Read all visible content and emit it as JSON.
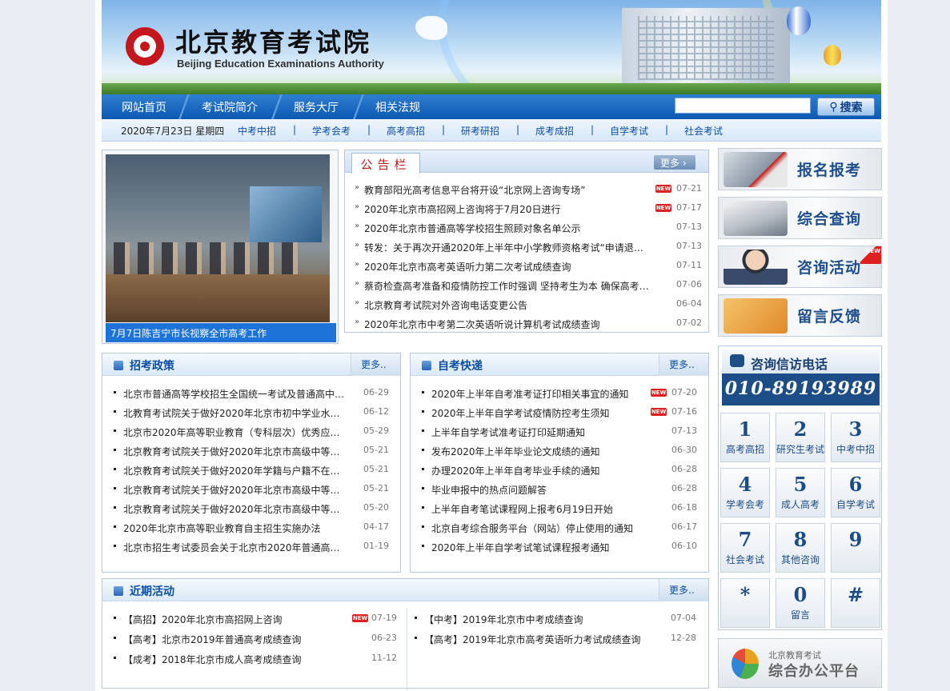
{
  "header": {
    "logo_cn": "北京教育考试院",
    "logo_en": "Beijing Education Examinations Authority"
  },
  "nav": {
    "items": [
      "网站首页",
      "考试院简介",
      "服务大厅",
      "相关法规"
    ],
    "search_placeholder": "",
    "search_button": "搜索"
  },
  "subnav": {
    "date": "2020年7月23日 星期四",
    "links": [
      "中考中招",
      "学考会考",
      "高考高招",
      "研考研招",
      "成考成招",
      "自学考试",
      "社会考试"
    ],
    "separator": "|"
  },
  "photo": {
    "caption": "7月7日陈吉宁市长视察全市高考工作"
  },
  "notice": {
    "tab": "公告栏",
    "more": "更多",
    "items": [
      {
        "title": "教育部阳光高考信息平台将开设“北京网上咨询专场”",
        "date": "07-21",
        "new": true
      },
      {
        "title": "2020年北京市高招网上咨询将于7月20日进行",
        "date": "07-17",
        "new": true
      },
      {
        "title": "2020年北京市普通高等学校招生照顾对象名单公示",
        "date": "07-13",
        "new": false
      },
      {
        "title": "转发：关于再次开通2020年上半年中小学教师资格考试“申请退费…",
        "date": "07-13",
        "new": false
      },
      {
        "title": "2020年北京市高考英语听力第二次考试成绩查询",
        "date": "07-11",
        "new": false
      },
      {
        "title": "蔡奇检查高考准备和疫情防控工作时强调 坚持考生为本 确保高考…",
        "date": "07-06",
        "new": false
      },
      {
        "title": "北京教育考试院对外咨询电话变更公告",
        "date": "06-04",
        "new": false
      },
      {
        "title": "2020年北京市中考第二次英语听说计算机考试成绩查询",
        "date": "07-02",
        "new": false
      }
    ]
  },
  "policy": {
    "title": "招考政策",
    "more": "更多..",
    "items": [
      {
        "title": "北京市普通高等学校招生全国统一考试及普通高中…",
        "date": "06-29"
      },
      {
        "title": "北教育考试院关于做好2020年北京市初中学业水平…",
        "date": "06-12"
      },
      {
        "title": "北京市2020年高等职业教育（专科层次）优秀应届…",
        "date": "05-29"
      },
      {
        "title": "北京教育考试院关于做好2020年北京市高级中等学…",
        "date": "05-21"
      },
      {
        "title": "北京教育考试院关于做好2020年学籍与户籍不在同…",
        "date": "05-21"
      },
      {
        "title": "北京教育考试院关于做好2020年北京市高级中等学…",
        "date": "05-21"
      },
      {
        "title": "北京教育考试院关于做好2020年北京市高级中等学…",
        "date": "05-20"
      },
      {
        "title": "2020年北京市高等职业教育自主招生实施办法",
        "date": "04-17"
      },
      {
        "title": "北京市招生考试委员会关于北京市2020年普通高等…",
        "date": "01-19"
      }
    ]
  },
  "selfexam": {
    "title": "自考快递",
    "more": "更多..",
    "items": [
      {
        "title": "2020年上半年自考准考证打印相关事宜的通知",
        "date": "07-20",
        "new": true
      },
      {
        "title": "2020年上半年自学考试疫情防控考生须知",
        "date": "07-16",
        "new": true
      },
      {
        "title": "上半年自学考试准考证打印延期通知",
        "date": "07-13",
        "new": false
      },
      {
        "title": "发布2020年上半年毕业论文成绩的通知",
        "date": "06-30",
        "new": false
      },
      {
        "title": "办理2020年上半年自考毕业手续的通知",
        "date": "06-28",
        "new": false
      },
      {
        "title": "毕业申报中的热点问题解答",
        "date": "06-28",
        "new": false
      },
      {
        "title": "上半年自考笔试课程网上报考6月19日开始",
        "date": "06-18",
        "new": false
      },
      {
        "title": "北京自考综合服务平台（网站）停止使用的通知",
        "date": "06-17",
        "new": false
      },
      {
        "title": "2020年上半年自学考试笔试课程报考通知",
        "date": "06-10",
        "new": false
      }
    ]
  },
  "activities": {
    "title": "近期活动",
    "more": "更多..",
    "left": [
      {
        "title": "【高招】2020年北京市高招网上咨询",
        "date": "07-19",
        "new": true
      },
      {
        "title": "【高考】北京市2019年普通高考成绩查询",
        "date": "06-23",
        "new": false
      },
      {
        "title": "【成考】2018年北京市成人高考成绩查询",
        "date": "11-12",
        "new": false
      }
    ],
    "right": [
      {
        "title": "【中考】2019年北京市中考成绩查询",
        "date": "07-04",
        "new": false
      },
      {
        "title": "【高考】2019年北京市高考英语听力考试成绩查询",
        "date": "12-28",
        "new": false
      }
    ]
  },
  "sidebar": {
    "buttons": [
      {
        "label": "报名报考",
        "icon": "diploma-icon",
        "new": false
      },
      {
        "label": "综合查询",
        "icon": "notebook-pen-icon",
        "new": false
      },
      {
        "label": "咨询活动",
        "icon": "operator-icon",
        "new": true
      },
      {
        "label": "留言反馈",
        "icon": "envelope-icon",
        "new": false
      }
    ],
    "new_tag": "NEW"
  },
  "hotline": {
    "title": "咨询信访电话",
    "number": "010-89193989",
    "keys": [
      {
        "n": "1",
        "s": "高考高招"
      },
      {
        "n": "2",
        "s": "研究生考试"
      },
      {
        "n": "3",
        "s": "中考中招"
      },
      {
        "n": "4",
        "s": "学考会考"
      },
      {
        "n": "5",
        "s": "成人高考"
      },
      {
        "n": "6",
        "s": "自学考试"
      },
      {
        "n": "7",
        "s": "社会考试"
      },
      {
        "n": "8",
        "s": "其他咨询"
      },
      {
        "n": "9",
        "s": ""
      },
      {
        "n": "*",
        "s": ""
      },
      {
        "n": "0",
        "s": "留言"
      },
      {
        "n": "#",
        "s": ""
      }
    ]
  },
  "platform": {
    "small": "北京教育考试",
    "big": "综合办公平台"
  },
  "new_badge": "NEW"
}
